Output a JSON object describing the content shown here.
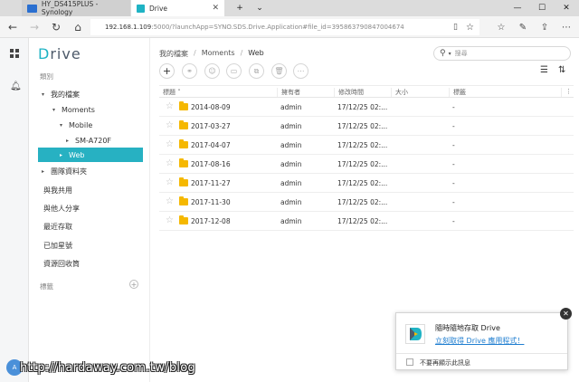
{
  "browser": {
    "tab1_title": "HY_DS415PLUS - Synology",
    "tab2_title": "Drive",
    "url_host": "192.168.1.109",
    "url_rest": ":5000/?launchApp=SYNO.SDS.Drive.Application#file_id=395863790847004674"
  },
  "sidebar": {
    "logo_prefix": "D",
    "logo_rest": "rive",
    "category_label": "類別",
    "tree": [
      {
        "label": "我的檔案",
        "caret": "▾",
        "indent": 0
      },
      {
        "label": "Moments",
        "caret": "▾",
        "indent": 1
      },
      {
        "label": "Mobile",
        "caret": "▾",
        "indent": 2
      },
      {
        "label": "SM-A720F",
        "caret": "▸",
        "indent": 3
      },
      {
        "label": "Web",
        "caret": "▸",
        "indent": 2,
        "selected": true
      },
      {
        "label": "團隊資料夾",
        "caret": "▸",
        "indent": 0
      }
    ],
    "links": [
      "與我共用",
      "與他人分享",
      "最近存取",
      "已加星號",
      "資源回收筒"
    ],
    "tags_label": "標籤"
  },
  "main": {
    "breadcrumb": [
      "我的檔案",
      "Moments",
      "Web"
    ],
    "search_placeholder": "搜尋",
    "columns": [
      "標題",
      "擁有者",
      "修改時間",
      "大小",
      "標籤"
    ],
    "rows": [
      {
        "title": "2014-08-09",
        "owner": "admin",
        "modified": "17/12/25 02:...",
        "size": "",
        "tag": "-"
      },
      {
        "title": "2017-03-27",
        "owner": "admin",
        "modified": "17/12/25 02:...",
        "size": "",
        "tag": "-"
      },
      {
        "title": "2017-04-07",
        "owner": "admin",
        "modified": "17/12/25 02:...",
        "size": "",
        "tag": "-"
      },
      {
        "title": "2017-08-16",
        "owner": "admin",
        "modified": "17/12/25 02:...",
        "size": "",
        "tag": "-"
      },
      {
        "title": "2017-11-27",
        "owner": "admin",
        "modified": "17/12/25 02:...",
        "size": "",
        "tag": "-"
      },
      {
        "title": "2017-11-30",
        "owner": "admin",
        "modified": "17/12/25 02:...",
        "size": "",
        "tag": "-"
      },
      {
        "title": "2017-12-08",
        "owner": "admin",
        "modified": "17/12/25 02:...",
        "size": "",
        "tag": "-"
      }
    ]
  },
  "notification": {
    "title": "隨時隨地存取 Drive",
    "link": "立刻取得 Drive 應用程式！",
    "checkbox_label": "不要再顯示此訊息"
  },
  "avatar_initials": "A",
  "watermark": "http://hardaway.com.tw/blog",
  "colors": {
    "accent": "#27b1c2",
    "link": "#1f7ed0",
    "folder": "#f5b800"
  }
}
